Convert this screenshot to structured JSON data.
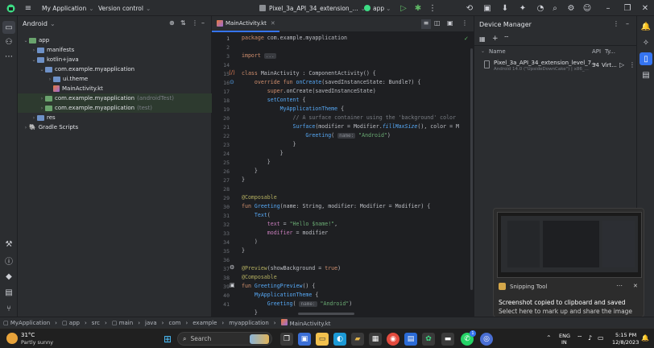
{
  "titlebar": {
    "project_label": "My Application",
    "vcs_label": "Version control",
    "device_label": "Pixel_3a_API_34_extension_...",
    "run_config": "app"
  },
  "project_panel": {
    "header": "Android",
    "tree": [
      {
        "label": "app",
        "indent": 0
      },
      {
        "label": "manifests",
        "indent": 1
      },
      {
        "label": "kotlin+java",
        "indent": 1
      },
      {
        "label": "com.example.myapplication",
        "indent": 2
      },
      {
        "label": "ui.theme",
        "indent": 3
      },
      {
        "label": "MainActivity.kt",
        "indent": 3
      },
      {
        "label": "com.example.myapplication",
        "suffix": "(androidTest)",
        "indent": 2
      },
      {
        "label": "com.example.myapplication",
        "suffix": "(test)",
        "indent": 2
      },
      {
        "label": "res",
        "indent": 1
      },
      {
        "label": "Gradle Scripts",
        "indent": 0
      }
    ]
  },
  "editor": {
    "tab_label": "MainActivity.kt",
    "line_numbers": [
      "1",
      "2",
      "3",
      "14",
      "15",
      "16",
      "17",
      "18",
      "19",
      "20",
      "21",
      "22",
      "23",
      "24",
      "25",
      "26",
      "27",
      "28",
      "29",
      "30",
      "31",
      "32",
      "33",
      "34",
      "35",
      "36",
      "37",
      "38",
      "39",
      "40",
      "41"
    ],
    "import_label": "import",
    "import_folded": "..."
  },
  "device_manager": {
    "title": "Device Manager",
    "col_name": "Name",
    "col_api": "API",
    "col_type": "Ty...",
    "device_name": "Pixel_3a_API_34_extension_level_7...",
    "device_sub": "Android 14.0 (\"UpsideDownCake\") | x86_...",
    "device_api": "34",
    "device_type": "Virt..."
  },
  "toast": {
    "app_name": "Snipping Tool",
    "title": "Screenshot copied to clipboard and saved",
    "body": "Select here to mark up and share the image"
  },
  "statusbar": {
    "crumbs": [
      "MyApplication",
      "app",
      "src",
      "main",
      "java",
      "com",
      "example",
      "myapplication",
      "MainActivity.kt"
    ]
  },
  "taskbar": {
    "weather_temp": "31°C",
    "weather_desc": "Partly sunny",
    "search_placeholder": "Search",
    "lang": "ENG",
    "lang_region": "IN",
    "time": "5:15 PM",
    "date": "12/8/2023",
    "notif_count": "1"
  },
  "colors": {
    "accent": "#3574f0",
    "keyword": "#cf8e6d",
    "function": "#56a8f5",
    "string": "#6aab73",
    "annotation": "#b3ae60"
  }
}
